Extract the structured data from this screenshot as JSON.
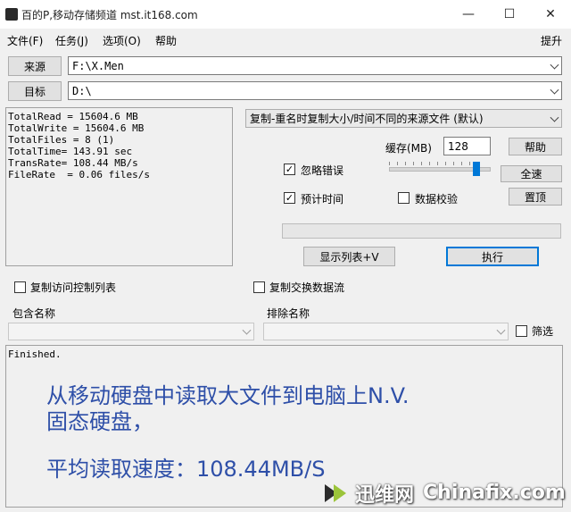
{
  "window": {
    "title": "百的P,移动存储频道 mst.it168.com",
    "minimize_glyph": "—",
    "maximize_glyph": "☐",
    "close_glyph": "✕"
  },
  "menu": {
    "file": "文件(F)",
    "task": "任务(J)",
    "options": "选项(O)",
    "help": "帮助",
    "elevate": "提升"
  },
  "source": {
    "button": "来源",
    "path": "F:\\X.Men"
  },
  "target": {
    "button": "目标",
    "path": "D:\\"
  },
  "stats_text": "TotalRead = 15604.6 MB\nTotalWrite = 15604.6 MB\nTotalFiles = 8 (1)\nTotalTime= 143.91 sec\nTransRate= 108.44 MB/s\nFileRate  = 0.06 files/s",
  "mode": {
    "selected": "复制-重名时复制大小/时间不同的来源文件 (默认)"
  },
  "buffer": {
    "label": "缓存(MB)",
    "value": "128"
  },
  "buttons": {
    "help": "帮助",
    "full_speed": "全速",
    "reset": "置顶",
    "show_list": "显示列表+V",
    "execute": "执行"
  },
  "options": {
    "ignore_errors": {
      "label": "忽略错误",
      "checked": true
    },
    "estimate_time": {
      "label": "预计时间",
      "checked": true
    },
    "verify": {
      "label": "数据校验",
      "checked": false
    },
    "copy_acl": {
      "label": "复制访问控制列表",
      "checked": false
    },
    "copy_streams": {
      "label": "复制交换数据流",
      "checked": false
    },
    "filter": {
      "label": "筛选",
      "checked": false
    }
  },
  "speed_slider_fraction": 0.88,
  "include": {
    "label": "包含名称"
  },
  "exclude": {
    "label": "排除名称"
  },
  "log": {
    "first_line": "Finished.",
    "overlay_line1": "从移动硬盘中读取大文件到电脑上N.V.",
    "overlay_line2": "固态硬盘，",
    "overlay_line3": "平均读取速度：108.44MB/S"
  },
  "watermark": {
    "brand_cn": "迅维网",
    "brand_en": "Chinafix.com"
  },
  "colors": {
    "accent": "#0078d7",
    "overlay_text": "#2e4fa8"
  }
}
